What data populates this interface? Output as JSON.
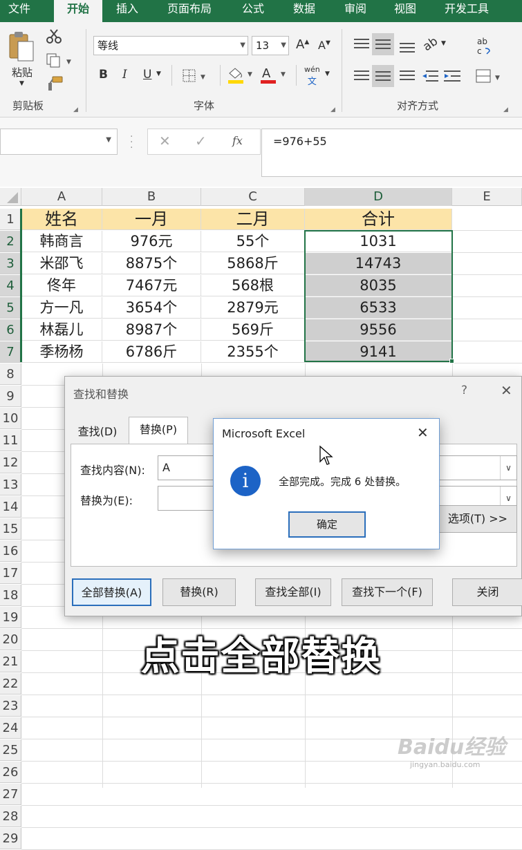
{
  "ribbon": {
    "tabs": [
      "文件",
      "开始",
      "插入",
      "页面布局",
      "公式",
      "数据",
      "审阅",
      "视图",
      "开发工具"
    ],
    "active_tab": "开始",
    "clipboard": {
      "paste_label": "粘贴",
      "group_label": "剪贴板"
    },
    "font": {
      "name": "等线",
      "size": "13",
      "group_label": "字体",
      "bold": "B",
      "italic": "I",
      "underline": "U",
      "phonetic": "wén"
    },
    "alignment": {
      "group_label": "对齐方式"
    },
    "font_color": "#e02020",
    "fill_color": "#ffd800"
  },
  "formula_bar": {
    "name_box": "",
    "formula": "=976+55",
    "fx": "fx"
  },
  "sheet": {
    "columns": [
      "A",
      "B",
      "C",
      "D",
      "E"
    ],
    "selected_column": "D",
    "row_numbers": [
      "1",
      "2",
      "3",
      "4",
      "5",
      "6",
      "7",
      "8",
      "9",
      "10",
      "11",
      "12",
      "13",
      "14",
      "15",
      "16",
      "17",
      "18",
      "19",
      "20",
      "21",
      "22",
      "23",
      "24",
      "25",
      "26",
      "27",
      "28",
      "29"
    ],
    "header_row": [
      "姓名",
      "一月",
      "二月",
      "合计"
    ],
    "rows": [
      [
        "韩商言",
        "976元",
        "55个",
        "1031"
      ],
      [
        "米邵飞",
        "8875个",
        "5868斤",
        "14743"
      ],
      [
        "佟年",
        "7467元",
        "568根",
        "8035"
      ],
      [
        "方一凡",
        "3654个",
        "2879元",
        "6533"
      ],
      [
        "林磊儿",
        "8987个",
        "569斤",
        "9556"
      ],
      [
        "季杨杨",
        "6786斤",
        "2355个",
        "9141"
      ]
    ],
    "header_fill": "#fce4a8"
  },
  "find_replace": {
    "title": "查找和替换",
    "help": "?",
    "tabs": [
      "查找(D)",
      "替换(P)"
    ],
    "find_label": "查找内容(N):",
    "find_value": "A",
    "replace_label": "替换为(E):",
    "replace_value": "",
    "options_button": "选项(T) >>",
    "buttons": [
      "全部替换(A)",
      "替换(R)",
      "查找全部(I)",
      "查找下一个(F)",
      "关闭"
    ]
  },
  "message_box": {
    "title": "Microsoft Excel",
    "text": "全部完成。完成 6 处替换。",
    "ok": "确定"
  },
  "caption": "点击全部替换",
  "watermark": {
    "brand": "Baidu经验",
    "url": "jingyan.baidu.com"
  }
}
